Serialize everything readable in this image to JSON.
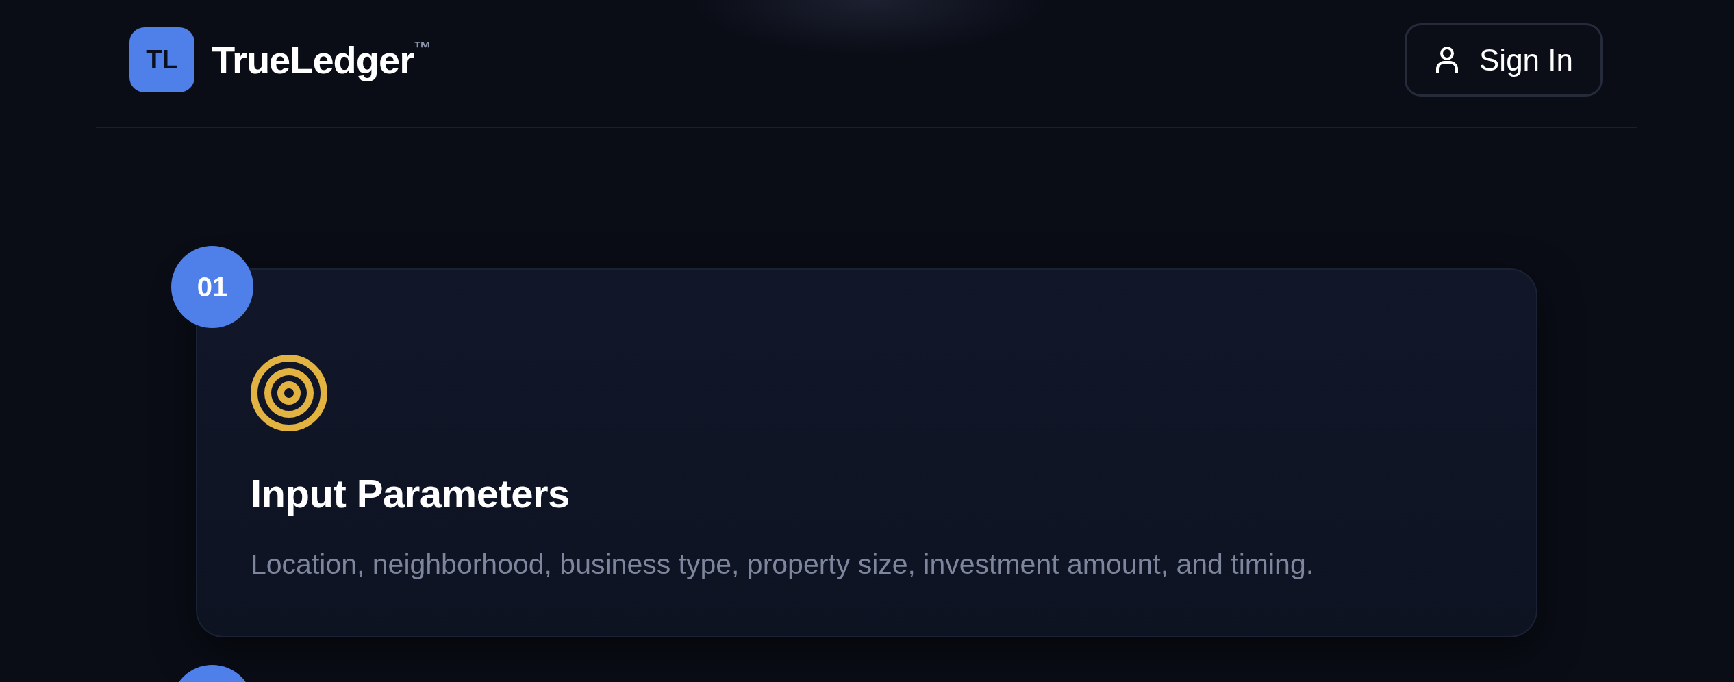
{
  "header": {
    "logo_mark": "TL",
    "brand": "TrueLedger",
    "trademark": "™",
    "sign_in": "Sign In"
  },
  "steps": [
    {
      "kind": "card",
      "number": "01",
      "title": "Input Parameters",
      "description": "Location, neighborhood, business type, property size, investment amount, and timing."
    },
    {
      "kind": "cut"
    }
  ]
}
